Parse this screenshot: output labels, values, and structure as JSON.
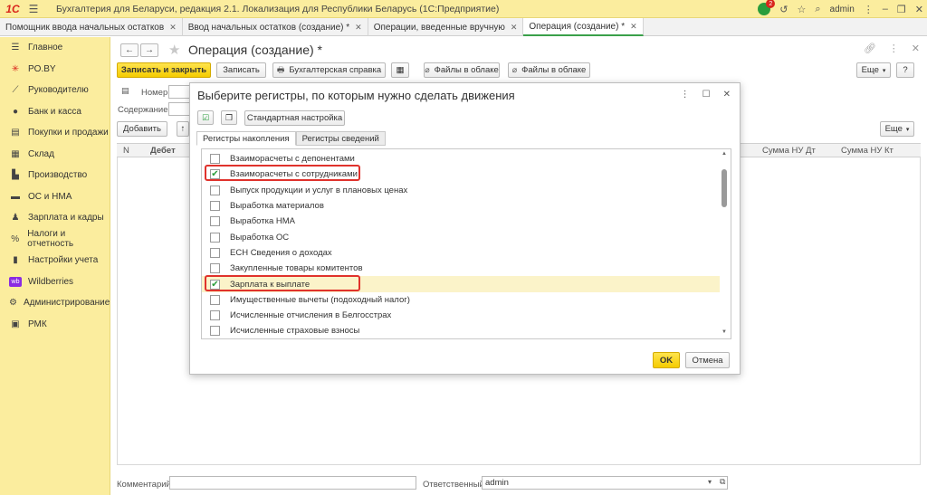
{
  "app": {
    "logo": "1С",
    "title": "Бухгалтерия для Беларуси, редакция 2.1. Локализация для Республики Беларусь  (1С:Предприятие)",
    "notifications_count": "2",
    "user": "admin"
  },
  "tabs": [
    {
      "label": "Помощник ввода начальных остатков"
    },
    {
      "label": "Ввод начальных остатков (создание) *"
    },
    {
      "label": "Операции, введенные вручную"
    },
    {
      "label": "Операция (создание) *"
    }
  ],
  "sidebar": {
    "items": [
      {
        "label": "Главное",
        "icon": "menu-icon"
      },
      {
        "label": "PO.BY",
        "icon": "po-by-icon"
      },
      {
        "label": "Руководителю",
        "icon": "chart-line-icon"
      },
      {
        "label": "Банк и касса",
        "icon": "coin-icon"
      },
      {
        "label": "Покупки и продажи",
        "icon": "cart-icon"
      },
      {
        "label": "Склад",
        "icon": "warehouse-icon"
      },
      {
        "label": "Производство",
        "icon": "factory-icon"
      },
      {
        "label": "ОС и НМА",
        "icon": "truck-icon"
      },
      {
        "label": "Зарплата и кадры",
        "icon": "person-icon"
      },
      {
        "label": "Налоги и отчетность",
        "icon": "tax-icon"
      },
      {
        "label": "Настройки учета",
        "icon": "book-icon"
      },
      {
        "label": "Wildberries",
        "icon": "wildberries-icon"
      },
      {
        "label": "Администрирование",
        "icon": "gear-icon"
      },
      {
        "label": "РМК",
        "icon": "register-icon"
      }
    ]
  },
  "form": {
    "title": "Операция (создание) *",
    "toolbar": {
      "save_close": "Записать и закрыть",
      "save": "Записать",
      "accounting_cert": "Бухгалтерская справка",
      "files_cloud_1": "Файлы в облаке",
      "files_cloud_2": "Файлы в облаке",
      "more": "Еще",
      "help": "?"
    },
    "number_label": "Номер:",
    "content_label": "Содержание:",
    "add_button": "Добавить",
    "more2": "Еще",
    "columns": [
      "N",
      "Дебет",
      "Сумма НУ Дт",
      "Сумма НУ Кт"
    ],
    "comment_label": "Комментарий:",
    "responsible_label": "Ответственный:",
    "responsible_value": "admin"
  },
  "dialog": {
    "title": "Выберите регистры, по которым нужно сделать движения",
    "std_settings": "Стандартная настройка",
    "tabs": [
      "Регистры накопления",
      "Регистры сведений"
    ],
    "items": [
      {
        "label": "Взаиморасчеты с депонентами",
        "checked": false
      },
      {
        "label": "Взаиморасчеты с сотрудниками",
        "checked": true
      },
      {
        "label": "Выпуск продукции и услуг в плановых ценах",
        "checked": false
      },
      {
        "label": "Выработка материалов",
        "checked": false
      },
      {
        "label": "Выработка НМА",
        "checked": false
      },
      {
        "label": "Выработка ОС",
        "checked": false
      },
      {
        "label": "ЕСН Сведения о доходах",
        "checked": false
      },
      {
        "label": "Закупленные товары комитентов",
        "checked": false
      },
      {
        "label": "Зарплата к выплате",
        "checked": true
      },
      {
        "label": "Имущественные вычеты (подоходный налог)",
        "checked": false
      },
      {
        "label": "Исчисленные отчисления в Белгосстрах",
        "checked": false
      },
      {
        "label": "Исчисленные страховые взносы",
        "checked": false
      }
    ],
    "ok": "OK",
    "cancel": "Отмена"
  },
  "colors": {
    "sidebar_bg": "#fbed9e",
    "accent_yellow": "#f5cc00",
    "highlight_red": "#e0322c",
    "check_green": "#2a9d3c"
  }
}
